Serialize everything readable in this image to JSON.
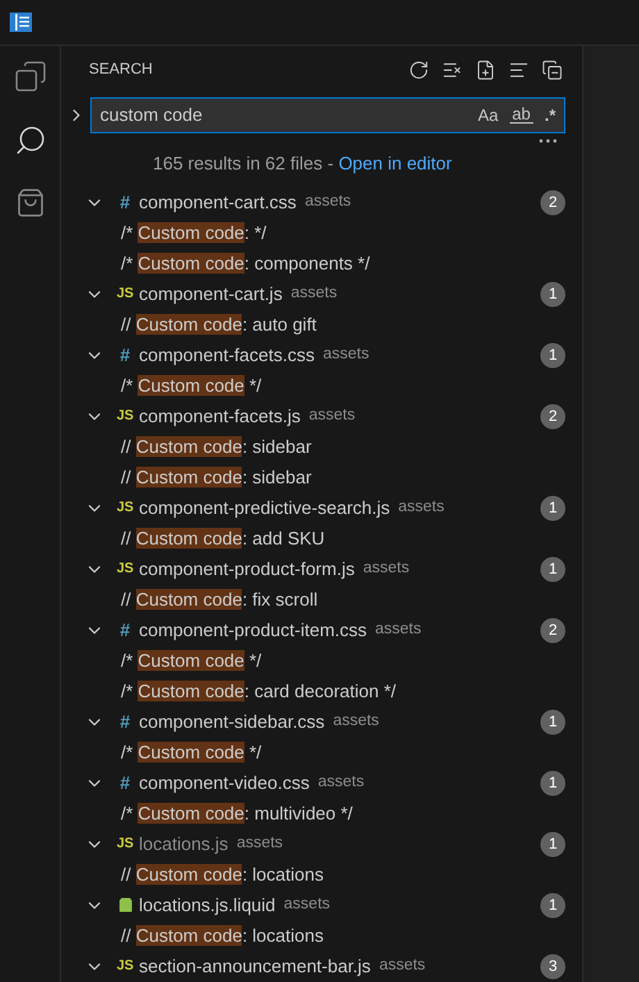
{
  "sidebar": {
    "title": "SEARCH"
  },
  "search": {
    "value": "custom code",
    "options": [
      {
        "label": "Aa",
        "kind": "case"
      },
      {
        "label": "ab",
        "kind": "word"
      },
      {
        "label": ".*",
        "kind": "regex"
      }
    ]
  },
  "summary": {
    "text": "165 results in 62 files - ",
    "link": "Open in editor"
  },
  "files": [
    {
      "icon": "#",
      "name": "component-cart.css",
      "folder": "assets",
      "kind": "css",
      "dimmed": false,
      "expanded": true,
      "count": "2",
      "matches": [
        {
          "before": "/* ",
          "match": "Custom code",
          "after": ": */"
        },
        {
          "before": "/* ",
          "match": "Custom code",
          "after": ": components */"
        }
      ]
    },
    {
      "icon": "JS",
      "name": "component-cart.js",
      "folder": "assets",
      "kind": "js",
      "dimmed": false,
      "expanded": true,
      "count": "1",
      "matches": [
        {
          "before": "// ",
          "match": "Custom code",
          "after": ": auto gift"
        }
      ]
    },
    {
      "icon": "#",
      "name": "component-facets.css",
      "folder": "assets",
      "kind": "css",
      "dimmed": false,
      "expanded": true,
      "count": "1",
      "matches": [
        {
          "before": "/* ",
          "match": "Custom code",
          "after": " */"
        }
      ]
    },
    {
      "icon": "JS",
      "name": "component-facets.js",
      "folder": "assets",
      "kind": "js",
      "dimmed": false,
      "expanded": true,
      "count": "2",
      "matches": [
        {
          "before": "// ",
          "match": "Custom code",
          "after": ": sidebar"
        },
        {
          "before": "// ",
          "match": "Custom code",
          "after": ": sidebar"
        }
      ]
    },
    {
      "icon": "JS",
      "name": "component-predictive-search.js",
      "folder": "assets",
      "kind": "js",
      "dimmed": false,
      "expanded": true,
      "count": "1",
      "matches": [
        {
          "before": "// ",
          "match": "Custom code",
          "after": ": add SKU"
        }
      ]
    },
    {
      "icon": "JS",
      "name": "component-product-form.js",
      "folder": "assets",
      "kind": "js",
      "dimmed": false,
      "expanded": true,
      "count": "1",
      "matches": [
        {
          "before": "// ",
          "match": "Custom code",
          "after": ": fix scroll"
        }
      ]
    },
    {
      "icon": "#",
      "name": "component-product-item.css",
      "folder": "assets",
      "kind": "css",
      "dimmed": false,
      "expanded": true,
      "count": "2",
      "matches": [
        {
          "before": "/* ",
          "match": "Custom code",
          "after": " */"
        },
        {
          "before": "/* ",
          "match": "Custom code",
          "after": ": card decoration */"
        }
      ]
    },
    {
      "icon": "#",
      "name": "component-sidebar.css",
      "folder": "assets",
      "kind": "css",
      "dimmed": false,
      "expanded": true,
      "count": "1",
      "matches": [
        {
          "before": "/* ",
          "match": "Custom code",
          "after": " */"
        }
      ]
    },
    {
      "icon": "#",
      "name": "component-video.css",
      "folder": "assets",
      "kind": "css",
      "dimmed": false,
      "expanded": true,
      "count": "1",
      "matches": [
        {
          "before": "/* ",
          "match": "Custom code",
          "after": ": multivideo */"
        }
      ]
    },
    {
      "icon": "JS",
      "name": "locations.js",
      "folder": "assets",
      "kind": "js",
      "dimmed": true,
      "expanded": true,
      "count": "1",
      "matches": [
        {
          "before": "// ",
          "match": "Custom code",
          "after": ": locations"
        }
      ]
    },
    {
      "name": "locations.js.liquid",
      "folder": "assets",
      "kind": "liquid",
      "dimmed": false,
      "expanded": true,
      "count": "1",
      "matches": [
        {
          "before": "// ",
          "match": "Custom code",
          "after": ": locations"
        }
      ]
    },
    {
      "icon": "JS",
      "name": "section-announcement-bar.js",
      "folder": "assets",
      "kind": "js",
      "dimmed": false,
      "expanded": true,
      "count": "3"
    }
  ]
}
